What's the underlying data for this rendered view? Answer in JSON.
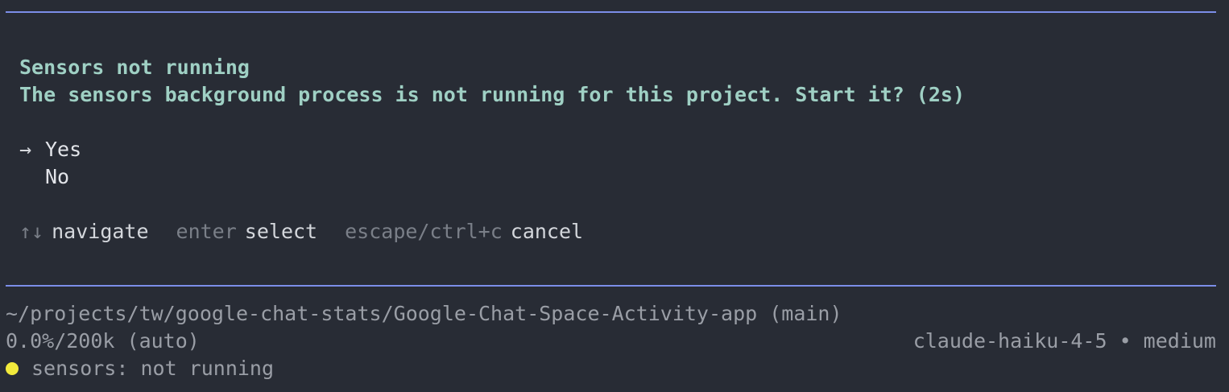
{
  "dialog": {
    "title": "Sensors not running",
    "message": "The sensors background process is not running for this project. Start it? (2s)",
    "cursor_glyph": "→",
    "options": [
      {
        "label": "Yes",
        "selected": true
      },
      {
        "label": "No",
        "selected": false
      }
    ],
    "hints": [
      {
        "key": "↑↓",
        "action": "navigate"
      },
      {
        "key": "enter",
        "action": "select"
      },
      {
        "key": "escape/ctrl+c",
        "action": "cancel"
      }
    ]
  },
  "status": {
    "path": "~/projects/tw/google-chat-stats/Google-Chat-Space-Activity-app (main)",
    "context_usage": "0.0%/200k (auto)",
    "model": "claude-haiku-4-5 • medium",
    "sensors_text": "sensors: not running",
    "sensors_dot_color": "#f2ea3c"
  },
  "colors": {
    "background": "#282c35",
    "rule": "#7c8ee8",
    "title": "#9fd0c4",
    "muted": "#9a9ea6"
  }
}
